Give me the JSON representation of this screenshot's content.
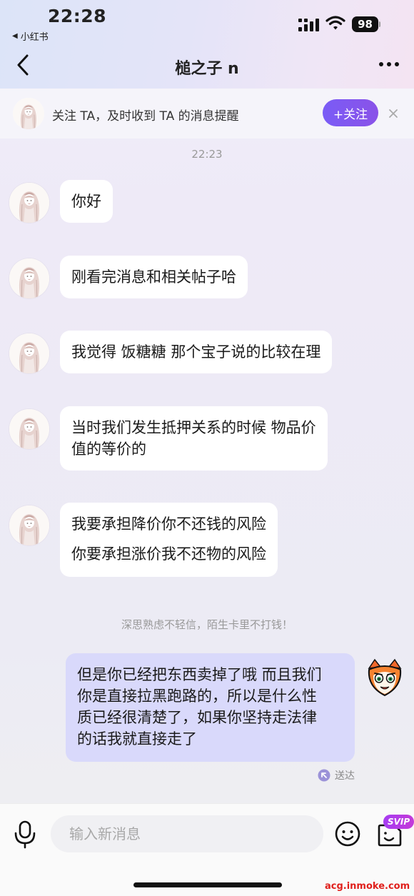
{
  "status_bar": {
    "time": "22:28",
    "back_app": "小红书",
    "battery": "98"
  },
  "header": {
    "title": "槌之子 n"
  },
  "follow_banner": {
    "text": "关注 TA，及时收到 TA 的消息提醒",
    "follow_label": "+关注"
  },
  "chat": {
    "timestamp": "22:23",
    "messages": [
      {
        "lines": [
          "你好"
        ]
      },
      {
        "lines": [
          "刚看完消息和相关帖子哈"
        ]
      },
      {
        "lines": [
          "我觉得 饭糖糖 那个宝子说的比较在理"
        ]
      },
      {
        "lines": [
          "当时我们发生抵押关系的时候 物品价",
          "值的等价的"
        ]
      },
      {
        "lines": [
          "我要承担降价你不还钱的风险",
          "你要承担涨价我不还物的风险"
        ]
      }
    ],
    "notice": "深思熟虑不轻信，陌生卡里不打钱！",
    "my_message": {
      "lines": [
        "但是你已经把东西卖掉了哦 而且我们",
        "你是直接拉黑跑路的，所以是什么性",
        "质已经很清楚了，如果你坚持走法律",
        "的话我就直接走了"
      ],
      "status": "送达"
    }
  },
  "input_bar": {
    "placeholder": "输入新消息",
    "svip_badge": "SVIP"
  },
  "watermark": "acg.inmoke.com",
  "colors": {
    "accent": "#7a5cf6",
    "my_bubble": "#d9d9fb",
    "other_bubble": "#ffffff"
  }
}
